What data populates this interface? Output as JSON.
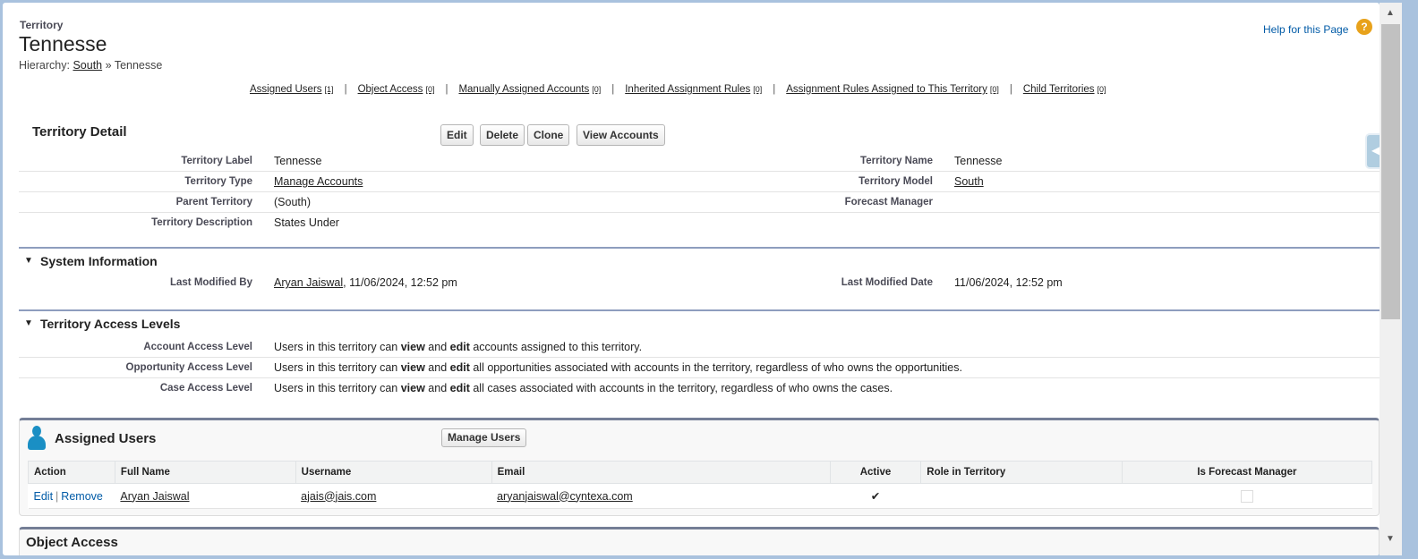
{
  "header": {
    "object_type": "Territory",
    "title": "Tennesse",
    "hierarchy_label": "Hierarchy:",
    "hierarchy_parent": "South",
    "hierarchy_sep": "»",
    "hierarchy_current": "Tennesse",
    "help": "Help for this Page"
  },
  "related_links": [
    {
      "label": "Assigned Users",
      "count": "[1]"
    },
    {
      "label": "Object Access",
      "count": "[0]"
    },
    {
      "label": "Manually Assigned Accounts",
      "count": "[0]"
    },
    {
      "label": "Inherited Assignment Rules",
      "count": "[0]"
    },
    {
      "label": "Assignment Rules Assigned to This Territory",
      "count": "[0]"
    },
    {
      "label": "Child Territories",
      "count": "[0]"
    }
  ],
  "separator": "|",
  "detail": {
    "title": "Territory Detail",
    "buttons": [
      "Edit",
      "Delete",
      "Clone",
      "View Accounts"
    ],
    "fields": [
      {
        "label": "Territory Label",
        "value": "Tennesse",
        "label2": "Territory Name",
        "value2": "Tennesse"
      },
      {
        "label": "Territory Type",
        "value": "Manage Accounts",
        "label2": "Territory Model",
        "value2": "South"
      },
      {
        "label": "Parent Territory",
        "value": "(South)",
        "label2": "Forecast Manager",
        "value2": ""
      },
      {
        "label": "Territory Description",
        "value": "States Under"
      }
    ]
  },
  "system": {
    "title": "System Information",
    "last_modified_by_label": "Last Modified By",
    "last_modified_by_user": "Aryan Jaiswal",
    "last_modified_by_date": ", 11/06/2024, 12:52 pm",
    "last_modified_date_label": "Last Modified Date",
    "last_modified_date": "11/06/2024, 12:52 pm"
  },
  "access": {
    "title": "Territory Access Levels",
    "prefix": "Users in this territory can ",
    "view": "view",
    "and": " and ",
    "edit": "edit",
    "rows": [
      {
        "label": "Account Access Level",
        "suffix": " accounts assigned to this territory."
      },
      {
        "label": "Opportunity Access Level",
        "suffix": " all opportunities associated with accounts in the territory, regardless of who owns the opportunities."
      },
      {
        "label": "Case Access Level",
        "suffix": " all cases associated with accounts in the territory, regardless of who owns the cases."
      }
    ]
  },
  "assigned_users": {
    "title": "Assigned Users",
    "button": "Manage Users",
    "columns": [
      "Action",
      "Full Name",
      "Username",
      "Email",
      "Active",
      "Role in Territory",
      "Is Forecast Manager"
    ],
    "rows": [
      {
        "edit": "Edit",
        "remove": "Remove",
        "full_name": "Aryan Jaiswal",
        "username": "ajais@jais.com",
        "email": "aryanjaiswal@cyntexa.com",
        "active": "✔",
        "role": "",
        "forecast_manager": false
      }
    ]
  },
  "object_access": {
    "title": "Object Access"
  }
}
